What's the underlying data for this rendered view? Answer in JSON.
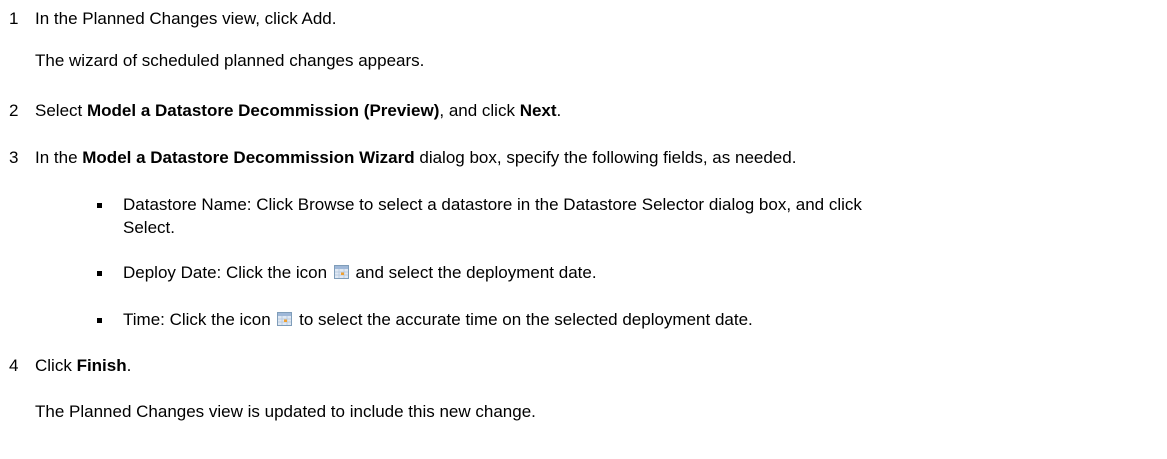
{
  "steps": [
    {
      "number": "1",
      "text": "In the Planned Changes view, click Add.",
      "result": "The wizard of scheduled planned changes appears."
    },
    {
      "number": "2",
      "pre": "Select ",
      "bold1": "Model a Datastore Decommission (Preview)",
      "mid": ", and click ",
      "bold2": "Next",
      "post": "."
    },
    {
      "number": "3",
      "pre": "In the ",
      "bold": "Model a Datastore Decommission Wizard",
      "post": " dialog box, specify the following fields, as needed.",
      "bullets": [
        {
          "line1": "Datastore Name: Click Browse to select a datastore in the Datastore Selector dialog box, and click",
          "line2": "Select."
        },
        {
          "pre": "Deploy Date: Click the icon ",
          "post": " and select the deployment date."
        },
        {
          "pre": "Time: Click the icon ",
          "post": " to select the accurate time on the selected deployment date."
        }
      ]
    },
    {
      "number": "4",
      "pre": "Click ",
      "bold": "Finish",
      "post": ".",
      "result": "The Planned Changes view is updated to include this new change."
    }
  ],
  "icons": {
    "calendar": "calendar-icon",
    "calendar_colors": {
      "border": "#7f9db9",
      "header": "#9fb8d8",
      "cell": "#dfe8f3",
      "highlight": "#f0a030"
    }
  }
}
